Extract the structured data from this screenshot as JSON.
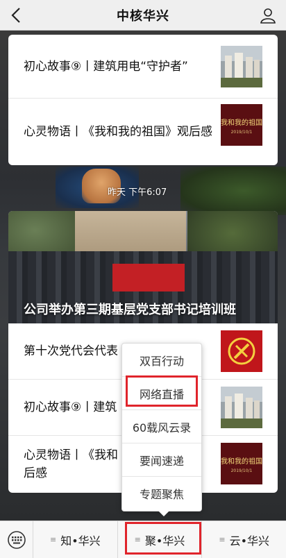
{
  "header": {
    "title": "中核华兴"
  },
  "card1": {
    "items": [
      {
        "title": "初心故事⑨丨建筑用电“守护者”",
        "thumb": "building-thumbnail"
      },
      {
        "title": "心灵物语丨《我和我的祖国》观后感",
        "thumb": "movie-poster-thumbnail",
        "thumb_text": "我和我的祖国",
        "thumb_date": "2019/10/1"
      }
    ]
  },
  "timestamp": "昨天 下午6:07",
  "card2": {
    "hero_caption": "公司举办第三期基层党支部书记培训班",
    "items": [
      {
        "title": "第十次党代会代表",
        "thumb": "party-emblem-thumbnail"
      },
      {
        "title": "初心故事⑨丨建筑",
        "thumb": "building-thumbnail"
      },
      {
        "title": "心灵物语丨《我和",
        "title2": "后感",
        "thumb": "movie-poster-thumbnail",
        "thumb_text": "我和我的祖国",
        "thumb_date": "2019/10/1"
      }
    ]
  },
  "popup_menu": {
    "items": [
      "双百行动",
      "网络直播",
      "60载风云录",
      "要闻速递",
      "专题聚焦"
    ],
    "highlighted": "网络直播"
  },
  "bottom_tabs": [
    "知•华兴",
    "聚•华兴",
    "云•华兴"
  ],
  "colors": {
    "highlight": "#e0242b",
    "party_red": "#c32025"
  }
}
